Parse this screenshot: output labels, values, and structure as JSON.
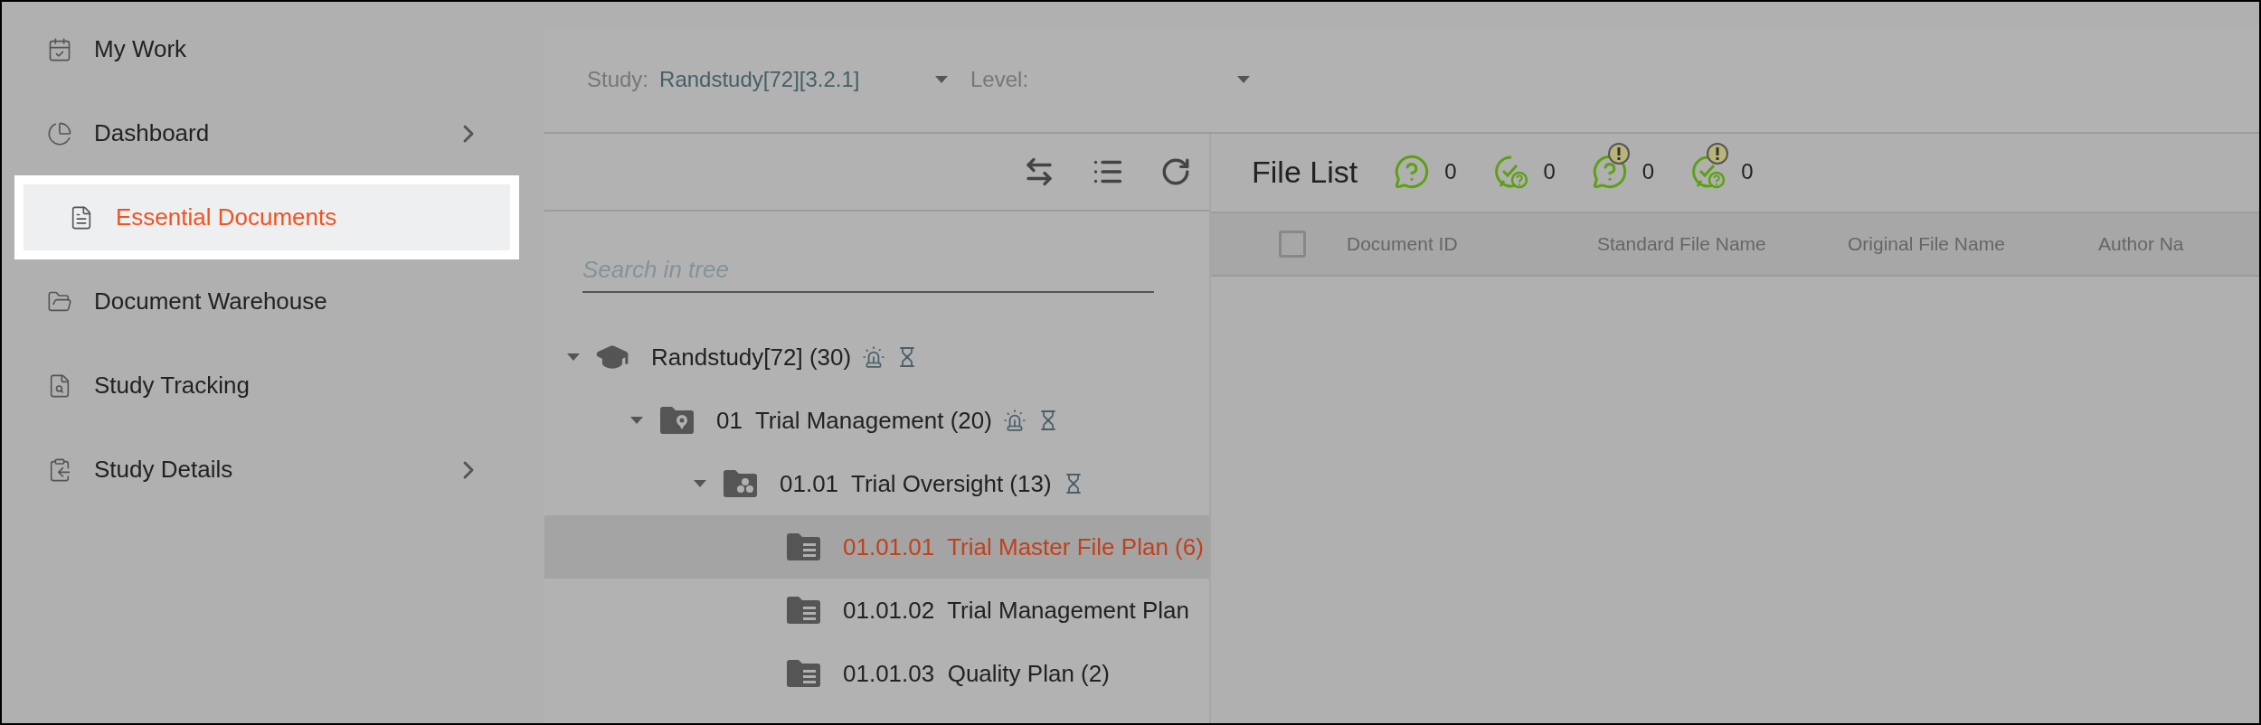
{
  "sidebar": {
    "items": [
      {
        "kind": "calendar",
        "label": "My Work",
        "selected": false,
        "has_submenu": false
      },
      {
        "kind": "pie",
        "label": "Dashboard",
        "selected": false,
        "has_submenu": true
      },
      {
        "kind": "document",
        "label": "Essential Documents",
        "selected": true,
        "has_submenu": false
      },
      {
        "kind": "folder",
        "label": "Document Warehouse",
        "selected": false,
        "has_submenu": false
      },
      {
        "kind": "search-doc",
        "label": "Study Tracking",
        "selected": false,
        "has_submenu": false
      },
      {
        "kind": "clipboard",
        "label": "Study Details",
        "selected": false,
        "has_submenu": true
      }
    ]
  },
  "filters": {
    "study": {
      "label": "Study:",
      "value": "Randstudy[72][3.2.1]"
    },
    "level": {
      "label": "Level:"
    }
  },
  "search": {
    "placeholder": "Search in tree"
  },
  "tree": [
    {
      "kind": "study",
      "label": "Randstudy[72] (30)",
      "alarm": true,
      "pending": true,
      "expanded": true,
      "selected": false,
      "children": [
        {
          "kind": "pin-folder",
          "label": "01  Trial Management (20)",
          "alarm": true,
          "pending": true,
          "expanded": true,
          "selected": false,
          "children": [
            {
              "kind": "group-folder",
              "label": "01.01  Trial Oversight (13)",
              "alarm": false,
              "pending": true,
              "expanded": true,
              "selected": false,
              "children": [
                {
                  "kind": "list-folder",
                  "label": "01.01.01  Trial Master File Plan (6)",
                  "alarm": false,
                  "pending": false,
                  "selected": true
                },
                {
                  "kind": "list-folder",
                  "label": "01.01.02  Trial Management Plan",
                  "alarm": false,
                  "pending": false,
                  "selected": false
                },
                {
                  "kind": "list-folder",
                  "label": "01.01.03  Quality Plan (2)",
                  "alarm": false,
                  "pending": false,
                  "selected": false
                }
              ]
            }
          ]
        }
      ]
    }
  ],
  "file_list": {
    "title": "File List",
    "counters": [
      {
        "kind": "question",
        "count": "0"
      },
      {
        "kind": "answered",
        "count": "0"
      },
      {
        "kind": "question-alert",
        "count": "0"
      },
      {
        "kind": "answered-alert",
        "count": "0"
      }
    ],
    "table": {
      "select_all": {
        "checked": false
      },
      "columns": [
        "Document ID",
        "Standard File Name",
        "Original File Name",
        "Author Na"
      ]
    }
  }
}
